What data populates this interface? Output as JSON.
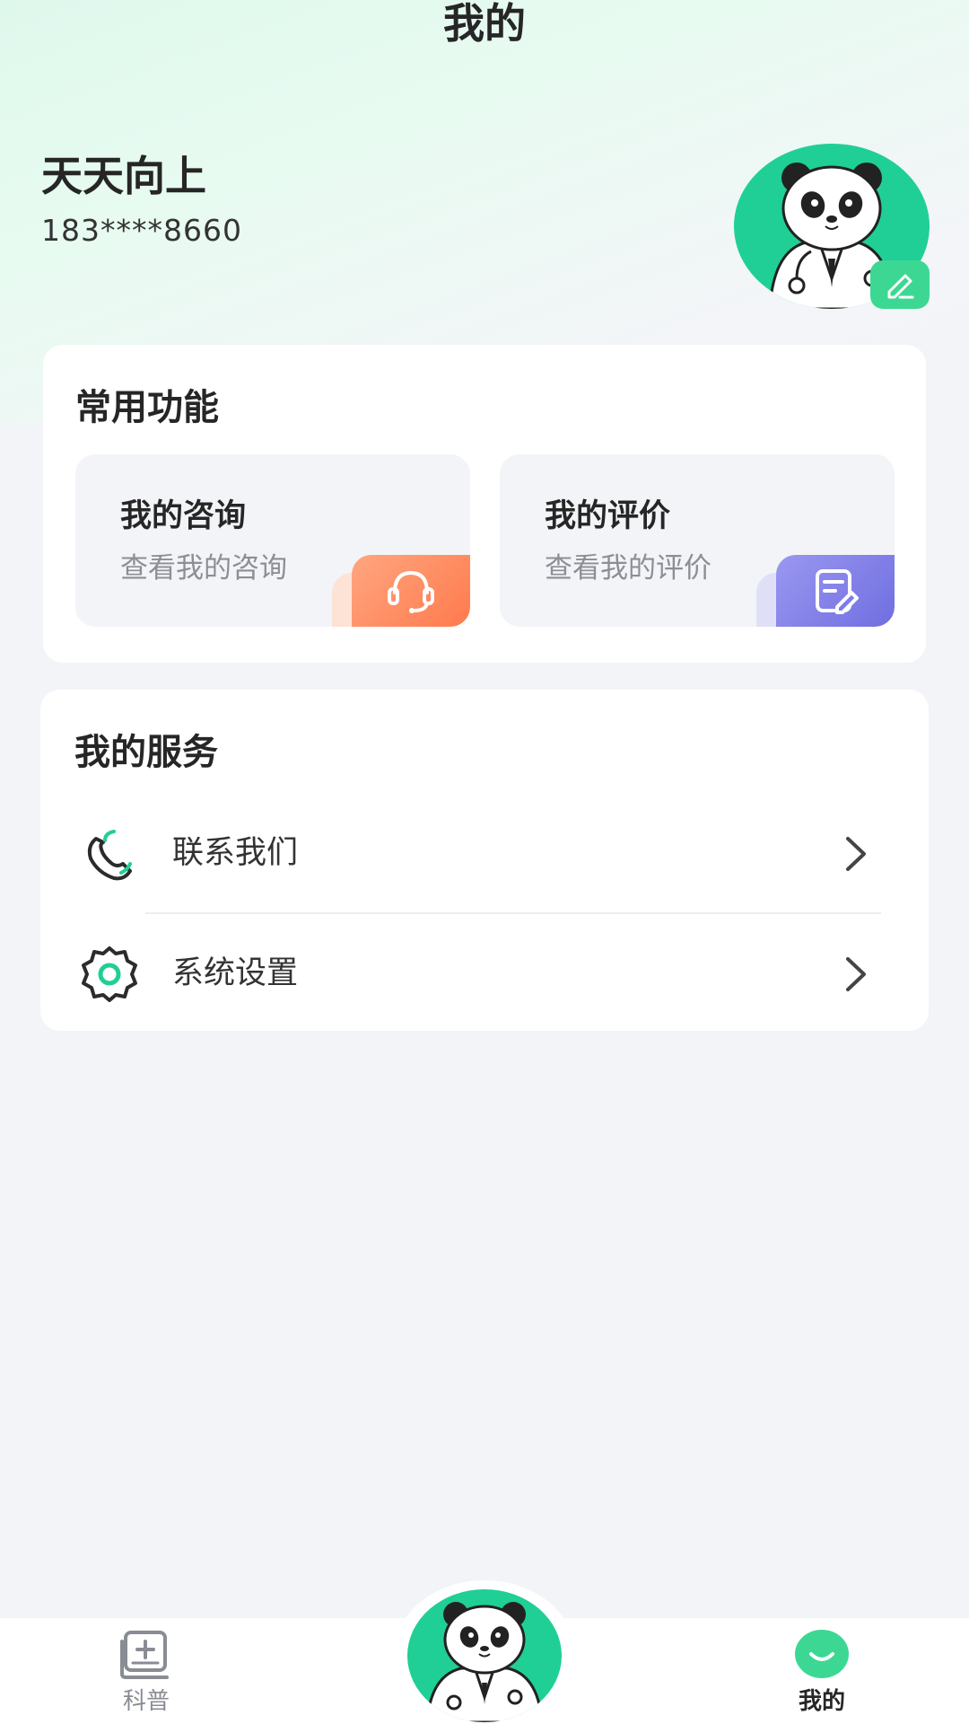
{
  "header": {
    "title": "我的"
  },
  "user": {
    "name": "天天向上",
    "phone": "183****8660"
  },
  "common": {
    "title": "常用功能",
    "tiles": [
      {
        "title": "我的咨询",
        "subtitle": "查看我的咨询",
        "icon": "headset-icon",
        "color": "#ff8a5b"
      },
      {
        "title": "我的评价",
        "subtitle": "查看我的评价",
        "icon": "edit-note-icon",
        "color": "#7e7ce8"
      }
    ]
  },
  "services": {
    "title": "我的服务",
    "items": [
      {
        "label": "联系我们",
        "icon": "phone-icon"
      },
      {
        "label": "系统设置",
        "icon": "gear-icon"
      }
    ]
  },
  "tabbar": {
    "tabs": [
      {
        "label": "科普",
        "icon": "book-plus-icon",
        "active": false
      },
      {
        "label": "",
        "icon": "panda-doctor-avatar",
        "active": false
      },
      {
        "label": "我的",
        "icon": "smile-icon",
        "active": true
      }
    ]
  },
  "colors": {
    "accent": "#20cf95",
    "background": "#f3f4f8",
    "text": "#262626"
  }
}
